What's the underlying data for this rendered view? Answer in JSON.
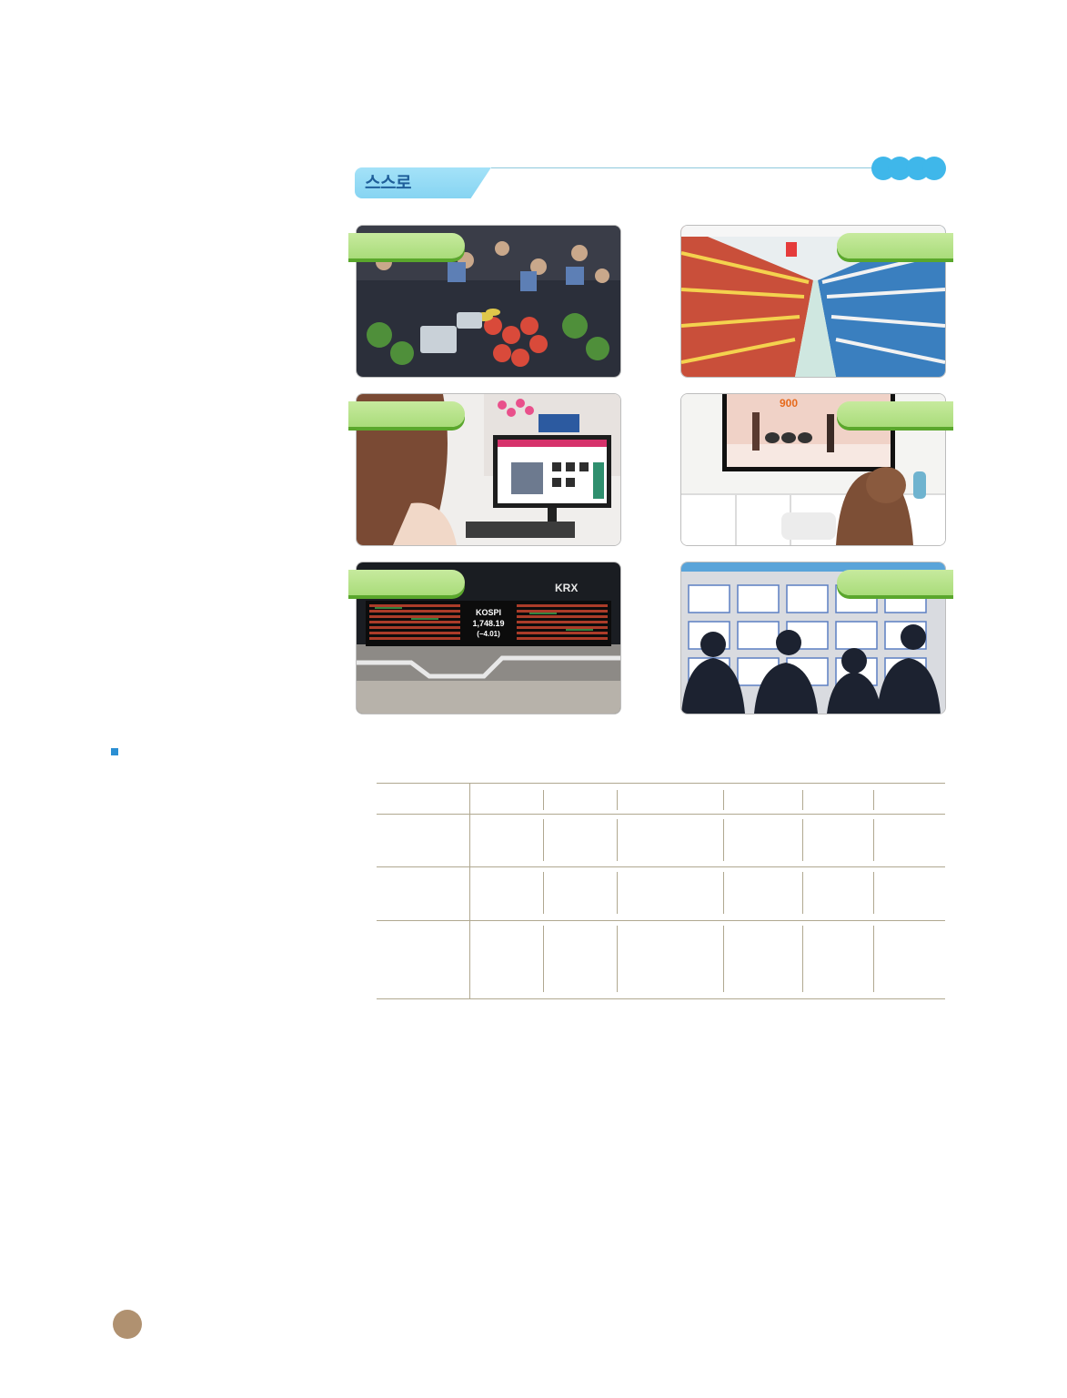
{
  "section": {
    "tab_label": "스스로"
  },
  "photos": [
    {
      "id": "market",
      "subject": "traditional-market"
    },
    {
      "id": "supermarket",
      "subject": "supermarket-aisle"
    },
    {
      "id": "online-shopping",
      "subject": "online-shopping"
    },
    {
      "id": "tv-shopping",
      "subject": "tv-home-shopping"
    },
    {
      "id": "stock-exchange",
      "subject": "stock-exchange-board"
    },
    {
      "id": "job-fair",
      "subject": "job-fair"
    }
  ],
  "stock_board": {
    "brand": "KRX",
    "index_name": "KOSPI",
    "index_value": "1,748.19",
    "index_change": "(−4.01)"
  },
  "tv_screen": {
    "price_sign": "900"
  },
  "colors": {
    "tab": "#86d4f2",
    "tab_text": "#1f5f9a",
    "dots": "#3fb7ea",
    "ribbon": "#a9dc7a",
    "ribbon_shadow": "#5aa72c",
    "bullet": "#2b8fd3",
    "table_lines": "#b0a890",
    "page_circle": "#b09170"
  }
}
